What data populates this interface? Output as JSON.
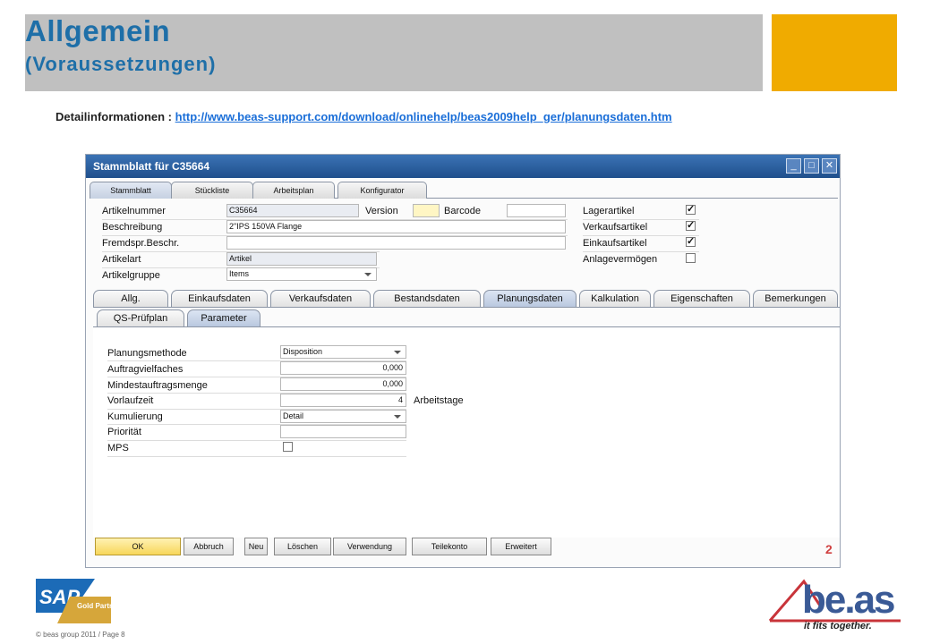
{
  "slide": {
    "title": "Allgemein",
    "subtitle": "(Voraussetzungen)",
    "detail_label": "Detailinformationen : ",
    "detail_link": "http://www.beas-support.com/download/onlinehelp/beas2009help_ger/planungsdaten.htm",
    "footer": "© beas group 2011 / Page 8",
    "beas_logo_text": "be.as",
    "beas_tagline": "it fits together.",
    "sap_logo_text": "SAP",
    "sap_partner_text": "Gold Partner"
  },
  "window": {
    "title": "Stammblatt für C35664",
    "top_tabs": [
      "Stammblatt",
      "Stückliste",
      "Arbeitsplan",
      "Konfigurator"
    ],
    "header": {
      "artikelnummer_label": "Artikelnummer",
      "artikelnummer_value": "C35664",
      "version_label": "Version",
      "version_value": "",
      "barcode_label": "Barcode",
      "barcode_value": "",
      "beschreibung_label": "Beschreibung",
      "beschreibung_value": "2\"IPS 150VA Flange",
      "fremdspr_label": "Fremdspr.Beschr.",
      "fremdspr_value": "",
      "artikelart_label": "Artikelart",
      "artikelart_value": "Artikel",
      "artikelgruppe_label": "Artikelgruppe",
      "artikelgruppe_value": "Items",
      "lagerartikel_label": "Lagerartikel",
      "verkaufsartikel_label": "Verkaufsartikel",
      "einkaufsartikel_label": "Einkaufsartikel",
      "anlagevermoegen_label": "Anlagevermögen",
      "check_mark": "✓"
    },
    "tabs": [
      "Allg.",
      "Einkaufsdaten",
      "Verkaufsdaten",
      "Bestandsdaten",
      "Planungsdaten",
      "Kalkulation",
      "Eigenschaften",
      "Bemerkungen"
    ],
    "subtabs": [
      "QS-Prüfplan",
      "Parameter"
    ],
    "planung": {
      "planungsmethode_label": "Planungsmethode",
      "planungsmethode_value": "Disposition",
      "auftragvielfaches_label": "Auftragvielfaches",
      "auftragvielfaches_value": "0,000",
      "mindestauftragsmenge_label": "Mindestauftragsmenge",
      "mindestauftragsmenge_value": "0,000",
      "vorlaufzeit_label": "Vorlaufzeit",
      "vorlaufzeit_value": "4",
      "vorlaufzeit_unit": "Arbeitstage",
      "kumulierung_label": "Kumulierung",
      "kumulierung_value": "Detail",
      "prioritaet_label": "Priorität",
      "prioritaet_value": "",
      "mps_label": "MPS"
    },
    "buttons": [
      "OK",
      "Abbruch",
      "Neu",
      "Löschen",
      "Verwendung",
      "Teilekonto",
      "Erweitert"
    ],
    "corner_mark": "2"
  }
}
